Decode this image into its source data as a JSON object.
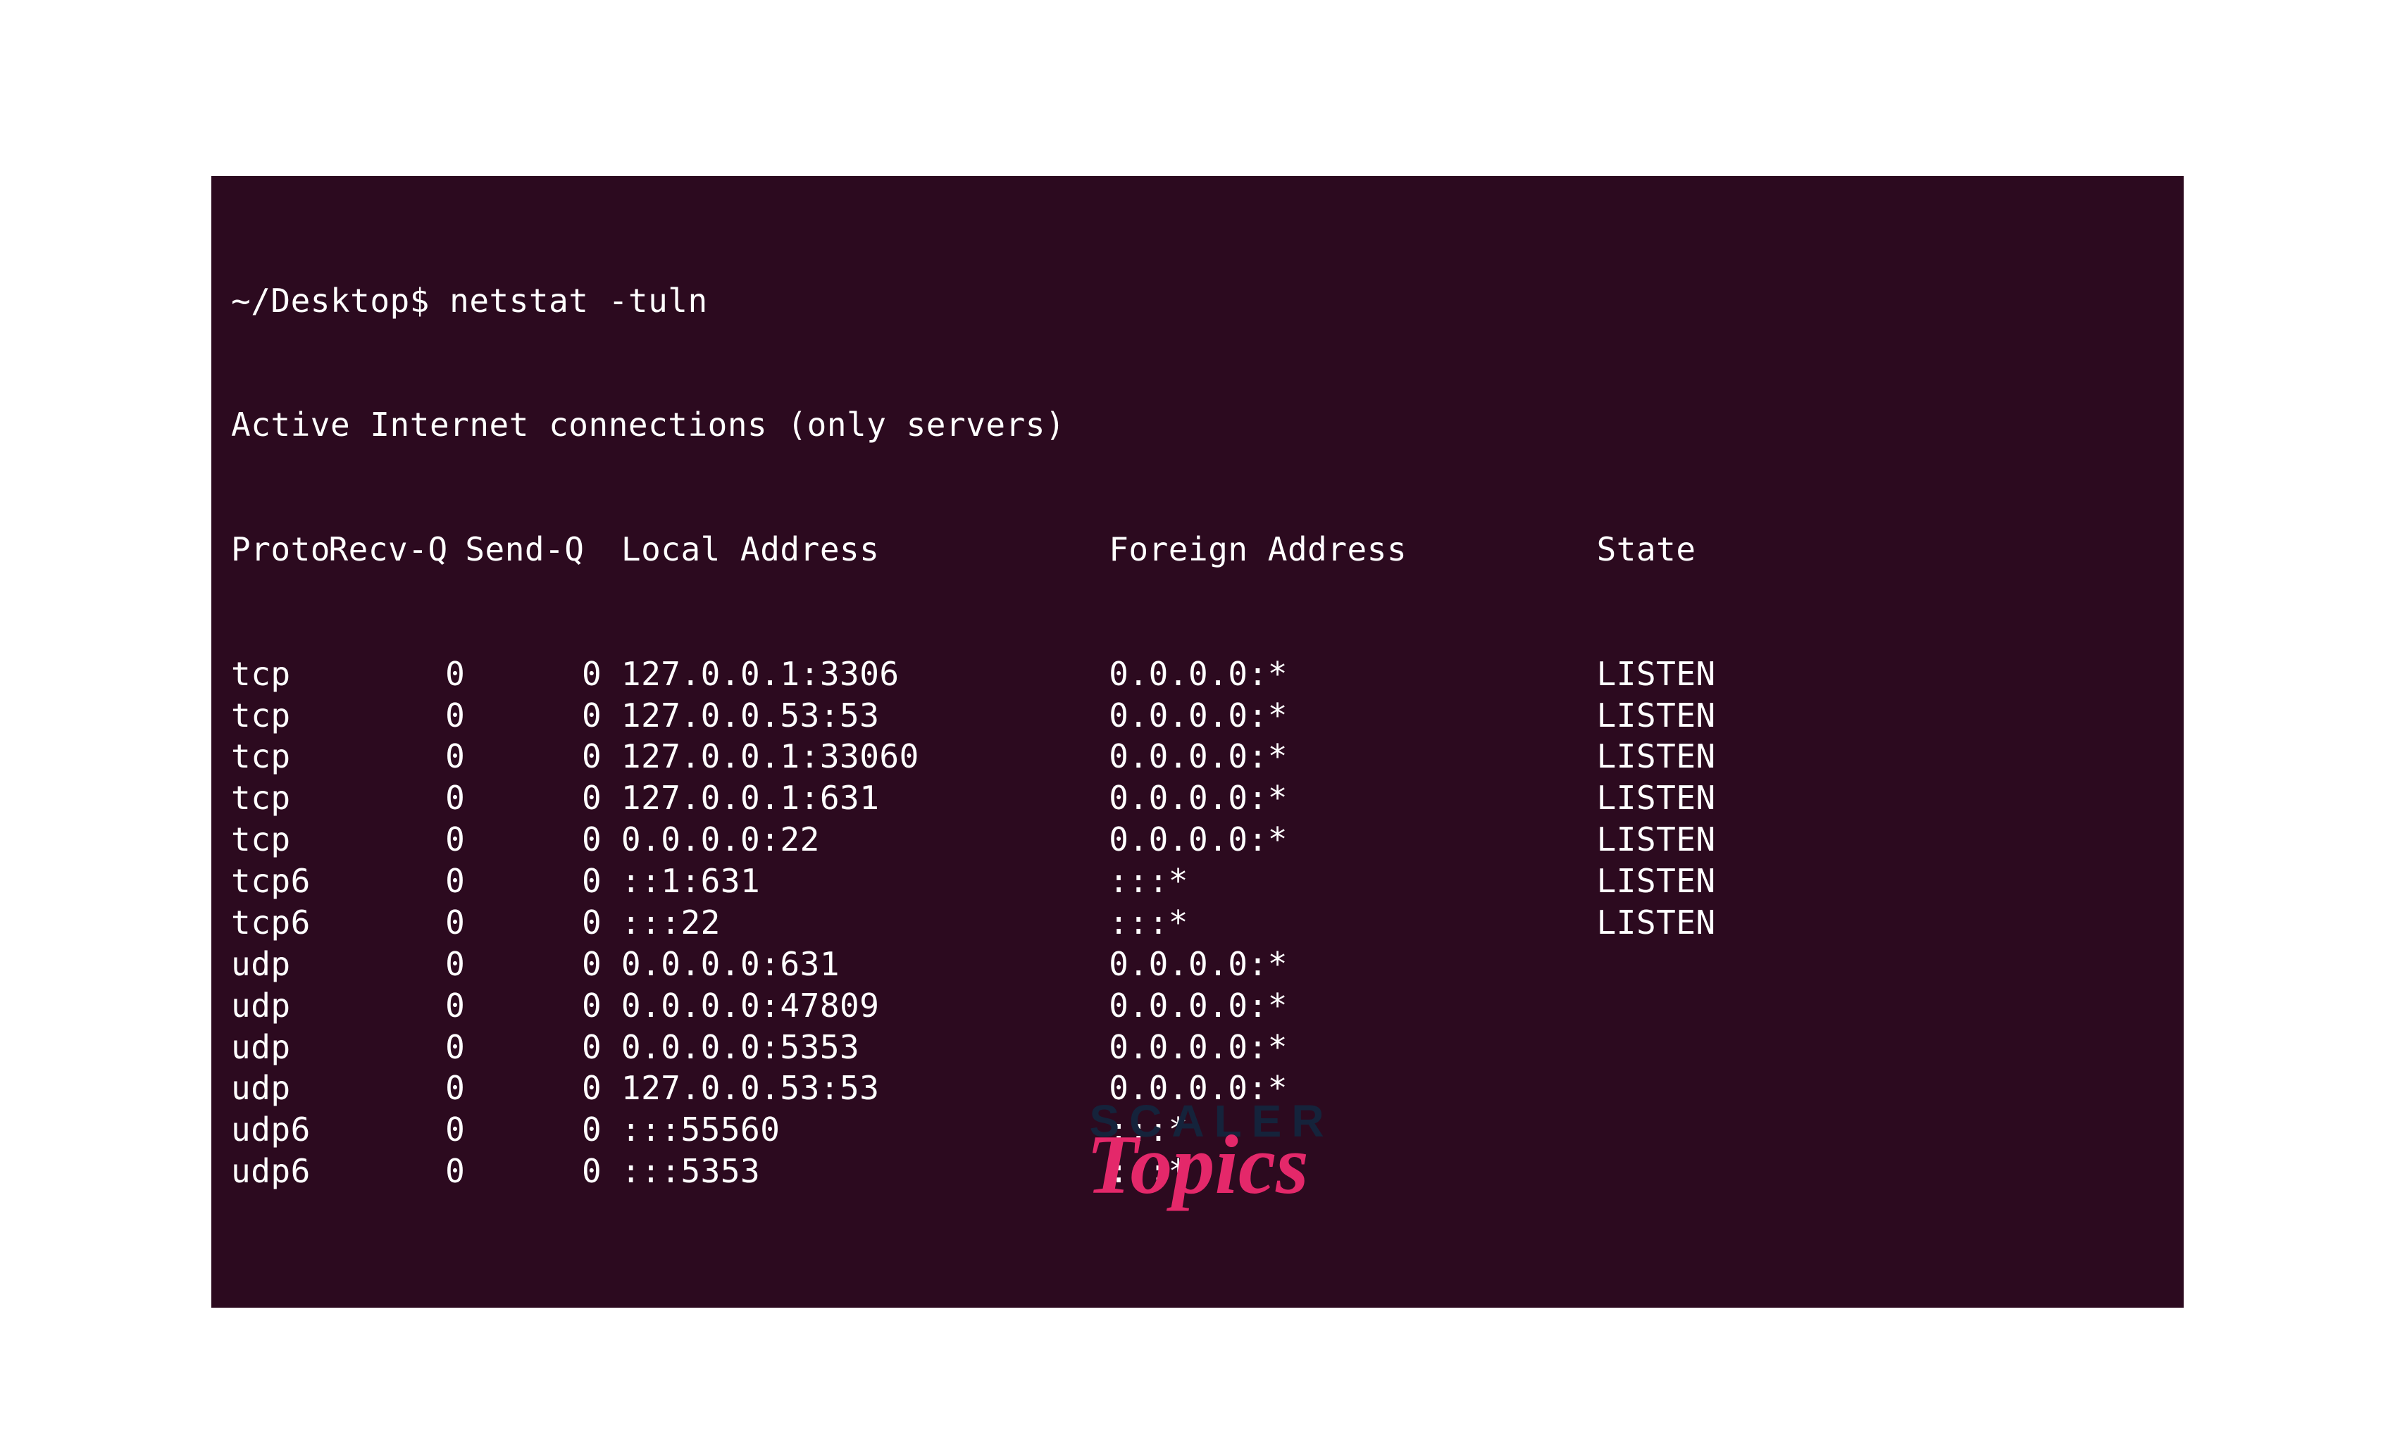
{
  "terminal": {
    "prompt": "~/Desktop$ ",
    "command": "netstat -tuln",
    "caption": "Active Internet connections (only servers)",
    "headers": {
      "proto": "Proto",
      "recvq": "Recv-Q",
      "sendq": "Send-Q",
      "local": "Local Address",
      "foreign": "Foreign Address",
      "state": "State"
    },
    "rows": [
      {
        "proto": "tcp",
        "recvq": "0",
        "sendq": "0",
        "local": "127.0.0.1:3306",
        "foreign": "0.0.0.0:*",
        "state": "LISTEN"
      },
      {
        "proto": "tcp",
        "recvq": "0",
        "sendq": "0",
        "local": "127.0.0.53:53",
        "foreign": "0.0.0.0:*",
        "state": "LISTEN"
      },
      {
        "proto": "tcp",
        "recvq": "0",
        "sendq": "0",
        "local": "127.0.0.1:33060",
        "foreign": "0.0.0.0:*",
        "state": "LISTEN"
      },
      {
        "proto": "tcp",
        "recvq": "0",
        "sendq": "0",
        "local": "127.0.0.1:631",
        "foreign": "0.0.0.0:*",
        "state": "LISTEN"
      },
      {
        "proto": "tcp",
        "recvq": "0",
        "sendq": "0",
        "local": "0.0.0.0:22",
        "foreign": "0.0.0.0:*",
        "state": "LISTEN"
      },
      {
        "proto": "tcp6",
        "recvq": "0",
        "sendq": "0",
        "local": "::1:631",
        "foreign": ":::*",
        "state": "LISTEN"
      },
      {
        "proto": "tcp6",
        "recvq": "0",
        "sendq": "0",
        "local": ":::22",
        "foreign": ":::*",
        "state": "LISTEN"
      },
      {
        "proto": "udp",
        "recvq": "0",
        "sendq": "0",
        "local": "0.0.0.0:631",
        "foreign": "0.0.0.0:*",
        "state": ""
      },
      {
        "proto": "udp",
        "recvq": "0",
        "sendq": "0",
        "local": "0.0.0.0:47809",
        "foreign": "0.0.0.0:*",
        "state": ""
      },
      {
        "proto": "udp",
        "recvq": "0",
        "sendq": "0",
        "local": "0.0.0.0:5353",
        "foreign": "0.0.0.0:*",
        "state": ""
      },
      {
        "proto": "udp",
        "recvq": "0",
        "sendq": "0",
        "local": "127.0.0.53:53",
        "foreign": "0.0.0.0:*",
        "state": ""
      },
      {
        "proto": "udp6",
        "recvq": "0",
        "sendq": "0",
        "local": ":::55560",
        "foreign": ":::*",
        "state": ""
      },
      {
        "proto": "udp6",
        "recvq": "0",
        "sendq": "0",
        "local": ":::5353",
        "foreign": ":::*",
        "state": ""
      }
    ]
  },
  "logo": {
    "top": "SCALER",
    "bottom": "Topics"
  }
}
